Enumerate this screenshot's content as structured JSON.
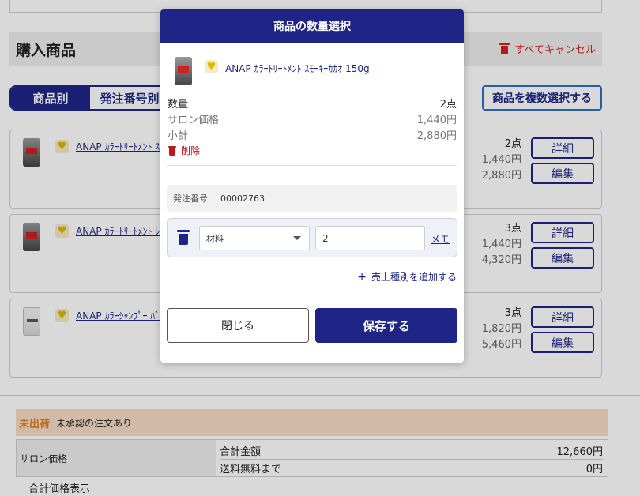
{
  "page": {
    "purchase_title": "購入商品",
    "cancel_all": "すべてキャンセル",
    "tabs": [
      {
        "label": "商品別",
        "active": true
      },
      {
        "label": "発注番号別",
        "active": false
      }
    ],
    "multi_select_label": "商品を複数選択する",
    "items": [
      {
        "name": "ANAP ｶﾗｰﾄﾘｰﾄﾒﾝﾄ ｽﾓ",
        "qty": "2点",
        "unit_price": "1,440円",
        "subtotal": "2,880円"
      },
      {
        "name": "ANAP ｶﾗｰﾄﾘｰﾄﾒﾝﾄ ﾚｯ",
        "qty": "3点",
        "unit_price": "1,440円",
        "subtotal": "4,320円"
      },
      {
        "name": "ANAP ｶﾗｰｼｬﾝﾌﾟｰ ﾊﾞｲ",
        "qty": "3点",
        "unit_price": "1,820円",
        "subtotal": "5,460円"
      }
    ],
    "detail_label": "詳細",
    "edit_label": "編集",
    "unshipped_tag": "未出荷",
    "unshipped_note": "未承認の注文あり",
    "salon_price_label": "サロン価格",
    "total_label": "合計金額",
    "total_value": "12,660円",
    "free_shipping_label": "送料無料まで",
    "free_shipping_value": "0円",
    "total_display_label": "合計価格表示"
  },
  "modal": {
    "title": "商品の数量選択",
    "product_name": "ANAP ｶﾗｰﾄﾘｰﾄﾒﾝﾄ ｽﾓｰｷｰｶｶｵ 150g",
    "quantity_label": "数量",
    "quantity_value": "2点",
    "salon_price_label": "サロン価格",
    "salon_price_value": "1,440円",
    "subtotal_label": "小計",
    "subtotal_value": "2,880円",
    "delete_label": "削除",
    "order_number_label": "発注番号",
    "order_number_value": "00002763",
    "sales_type_selected": "材料",
    "quantity_input_value": "2",
    "memo_label": "メモ",
    "add_sales_type_label": "売上種別を追加する",
    "close_label": "閉じる",
    "save_label": "保存する"
  },
  "colors": {
    "primary": "#1e2586",
    "danger": "#d41f1f",
    "unshipped_bg": "#f6dcc6",
    "unshipped_text": "#e07b1a"
  },
  "icons": [
    "trash-icon",
    "heart-icon",
    "chevron-down-icon",
    "plus-icon"
  ]
}
